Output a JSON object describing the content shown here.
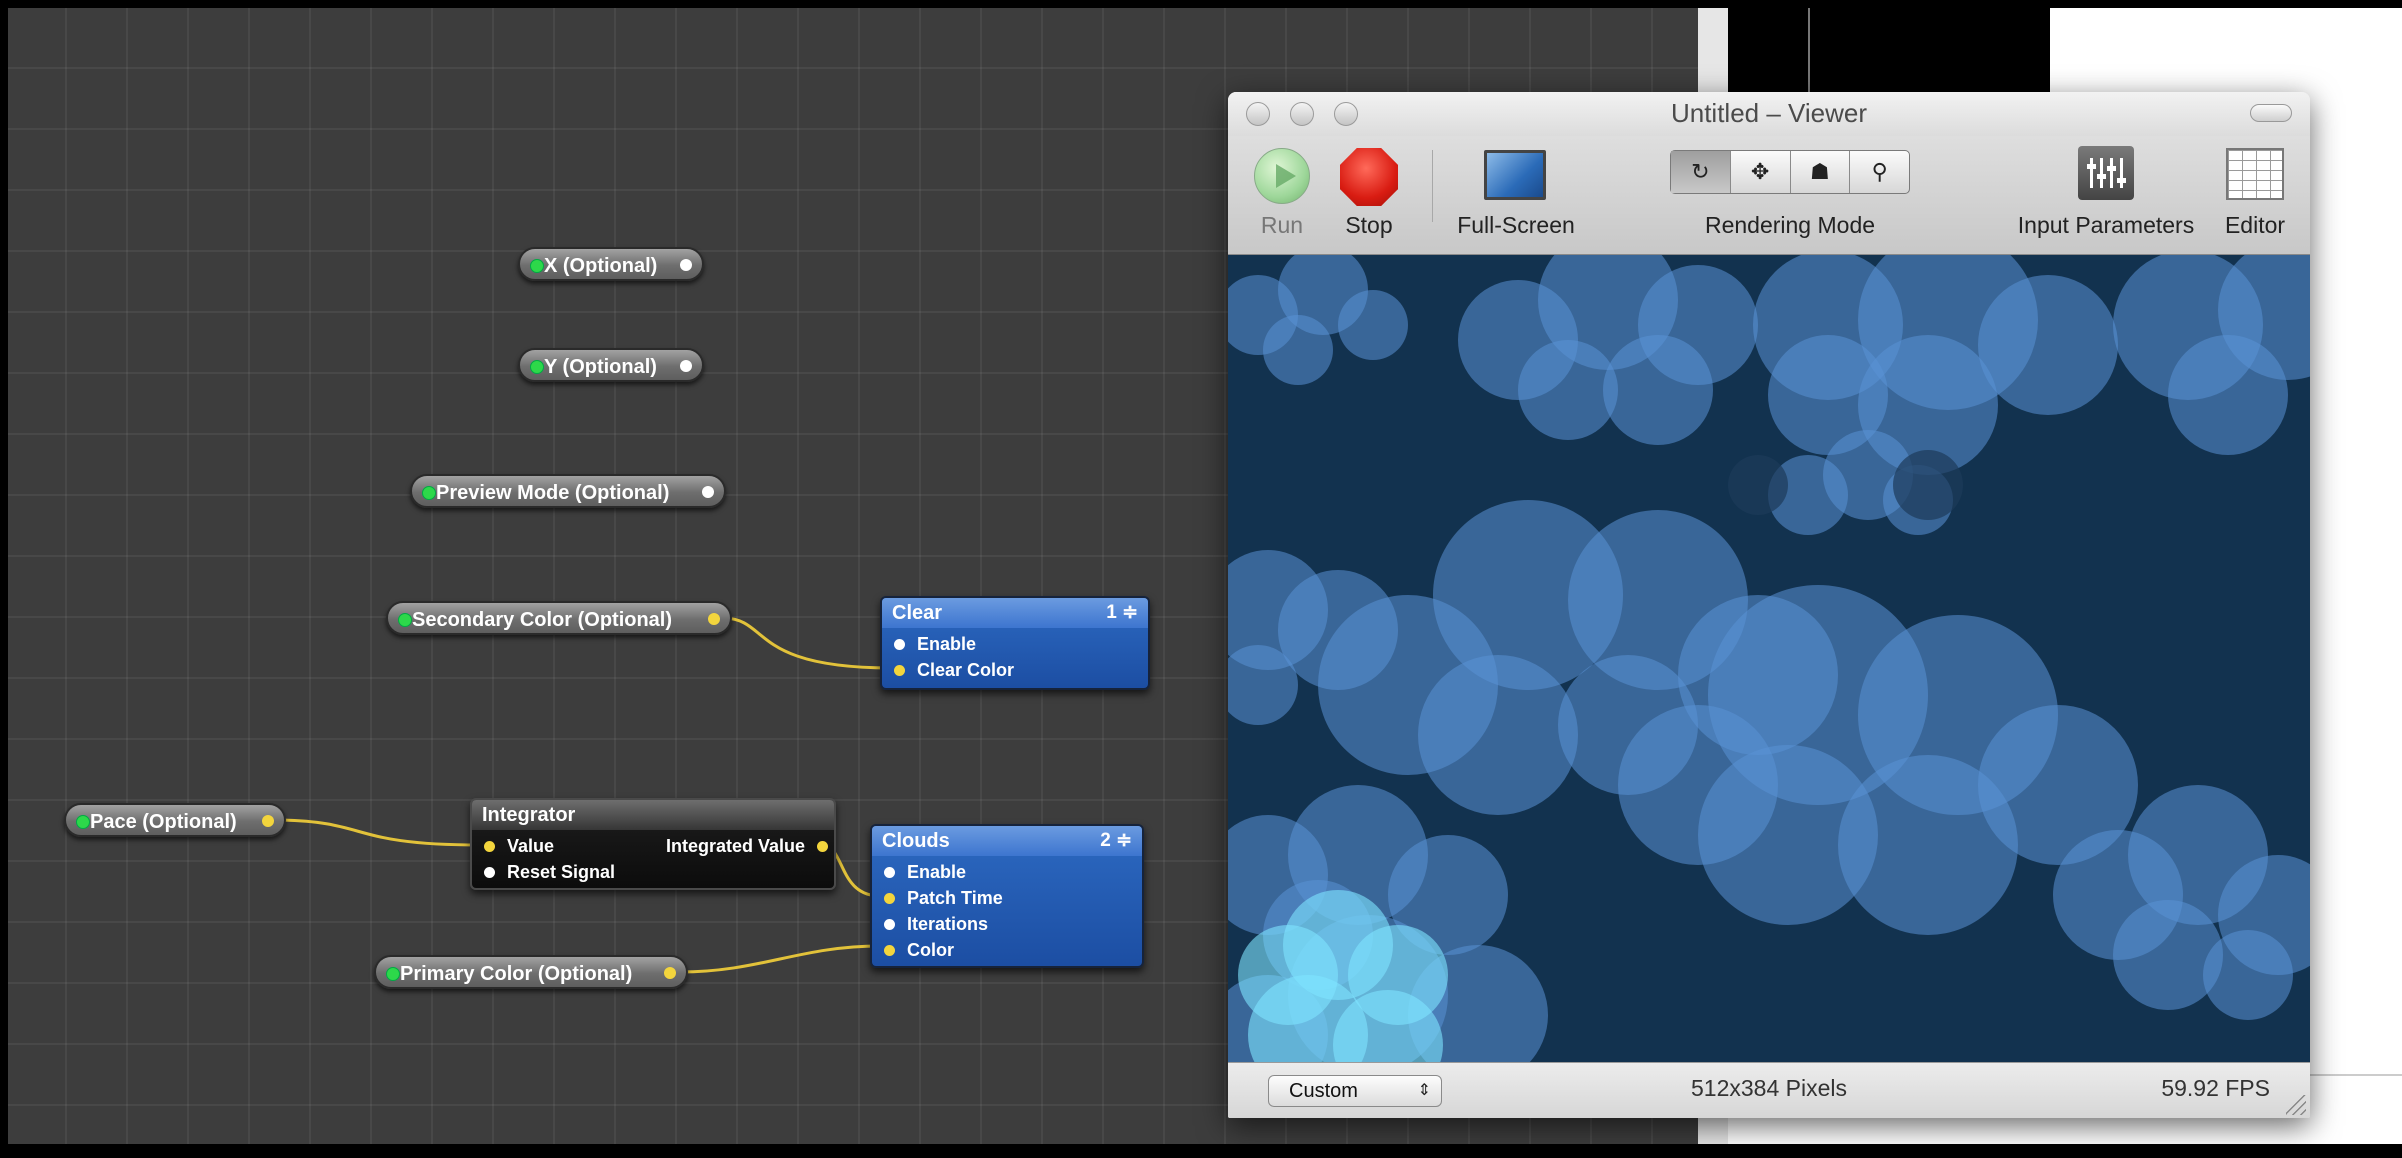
{
  "editor": {
    "published_inputs": [
      {
        "label": "X (Optional)"
      },
      {
        "label": "Y (Optional)"
      },
      {
        "label": "Preview Mode (Optional)"
      },
      {
        "label": "Secondary Color (Optional)"
      },
      {
        "label": "Pace (Optional)"
      },
      {
        "label": "Primary Color (Optional)"
      }
    ],
    "patches": {
      "clear": {
        "title": "Clear",
        "order": "1 ≑",
        "ports": [
          "Enable",
          "Clear Color"
        ]
      },
      "integrator": {
        "title": "Integrator",
        "inputs": [
          "Value",
          "Reset Signal"
        ],
        "output": "Integrated Value"
      },
      "clouds": {
        "title": "Clouds",
        "order": "2 ≑",
        "ports": [
          "Enable",
          "Patch Time",
          "Iterations",
          "Color"
        ]
      }
    },
    "colors": {
      "canvas": "#3d3d3d",
      "wire": "#e2c23a",
      "patch_blue": "#2d6ac2"
    }
  },
  "viewer": {
    "title": "Untitled – Viewer",
    "toolbar": {
      "run": "Run",
      "stop": "Stop",
      "fullscreen": "Full-Screen",
      "rendering_mode": "Rendering Mode",
      "rendering_mode_icons": [
        "rotate-icon",
        "move-icon",
        "bug-icon",
        "magnify-icon"
      ],
      "rendering_mode_selected": "rotate-icon",
      "input_parameters": "Input Parameters",
      "editor": "Editor"
    },
    "status": {
      "size_preset": "Custom",
      "pixels": "512x384 Pixels",
      "fps": "59.92 FPS"
    },
    "clouds": {
      "background": "#12324f",
      "light": "#5a92d6",
      "cyan": "#7fe4ff"
    }
  }
}
